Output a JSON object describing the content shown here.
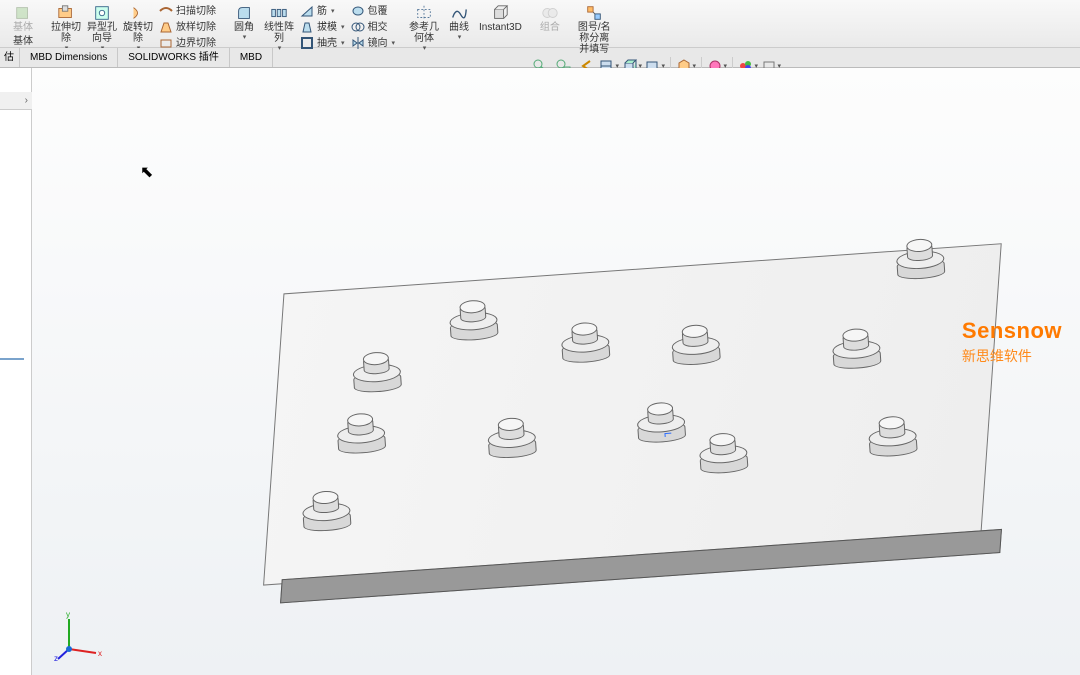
{
  "ribbon": {
    "col0": {
      "l1": "基体"
    },
    "extrude_cut": "拉伸切\n除",
    "hole_wizard": "异型孔\n向导",
    "revolve_cut": "旋转切\n除",
    "sweep_cut": "扫描切除",
    "loft_cut": "放样切除",
    "boundary_cut": "边界切除",
    "fillet": "圆角",
    "linear_pattern": "线性阵\n列",
    "rib": "筋",
    "draft": "拔模",
    "shell": "抽壳",
    "wrap": "包覆",
    "intersect": "相交",
    "mirror": "镜向",
    "ref_geom": "参考几\n何体",
    "curves": "曲线",
    "instant3d": "Instant3D",
    "combine": "组合",
    "split_name": "图号/名\n称分离\n并填写",
    "base_label": "基体"
  },
  "tabs": {
    "t0": "估",
    "t1": "MBD Dimensions",
    "t2": "SOLIDWORKS 插件",
    "t3": "MBD"
  },
  "viewbar": {
    "zoom_fit": "zoom-fit",
    "zoom_area": "zoom-area",
    "prev_view": "prev-view",
    "section": "section",
    "view_orient": "view-orient",
    "display_style": "display-style",
    "hide_show": "hide-show",
    "appearance": "appearance",
    "scene": "scene",
    "render": "render",
    "settings": "view-settings"
  },
  "watermark": {
    "brand": "Sensnow",
    "sub": "新思维软件"
  },
  "triad": {
    "x": "x",
    "y": "y",
    "z": "z"
  }
}
